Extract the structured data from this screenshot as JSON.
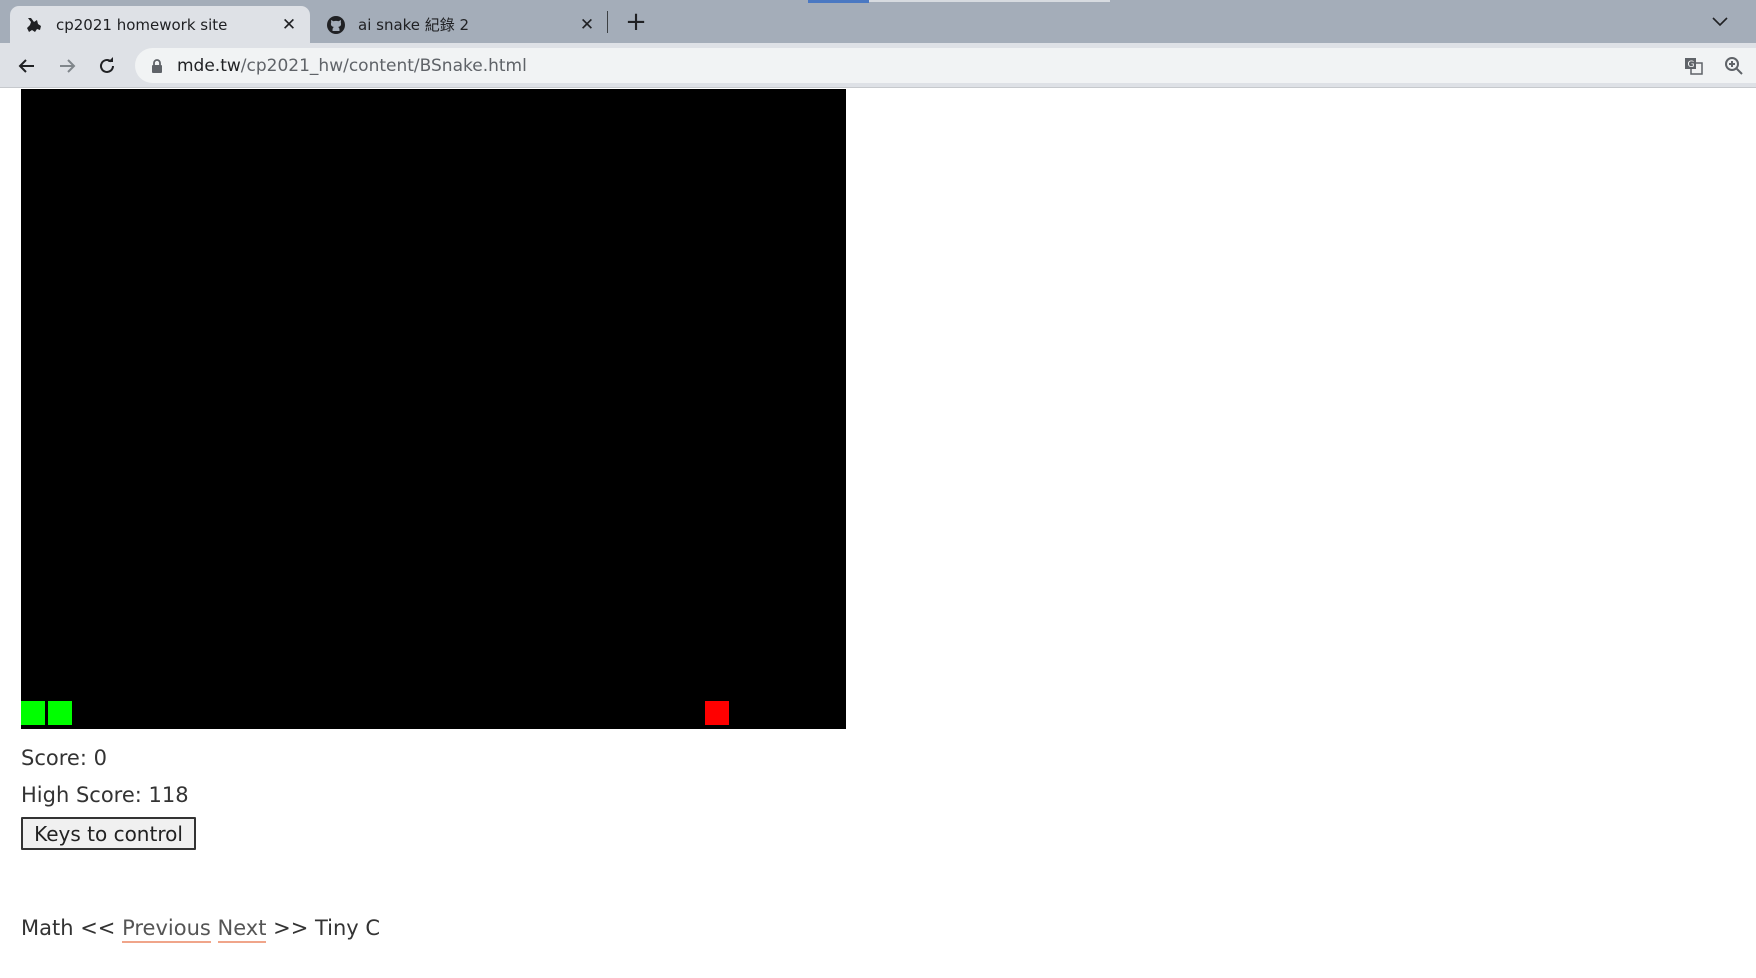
{
  "browser": {
    "tabs": [
      {
        "title": "cp2021 homework site",
        "favicon": "cat-icon",
        "active": true
      },
      {
        "title": "ai snake 紀錄 2",
        "favicon": "github-icon",
        "active": false
      }
    ],
    "close_glyph": "✕",
    "new_tab_glyph": "+",
    "url_host": "mde.tw",
    "url_path": "/cp2021_hw/content/BSnake.html"
  },
  "game": {
    "board_color": "#000000",
    "snake_color": "#00ff00",
    "food_color": "#ff0000",
    "snake_segments": 2
  },
  "page": {
    "score_label": "Score: 0",
    "high_score_label": "High Score: 118",
    "keys_button": "Keys to control",
    "nav_prefix": "Math << ",
    "previous_link": "Previous",
    "next_link": "Next",
    "nav_suffix": " >> Tiny C"
  }
}
